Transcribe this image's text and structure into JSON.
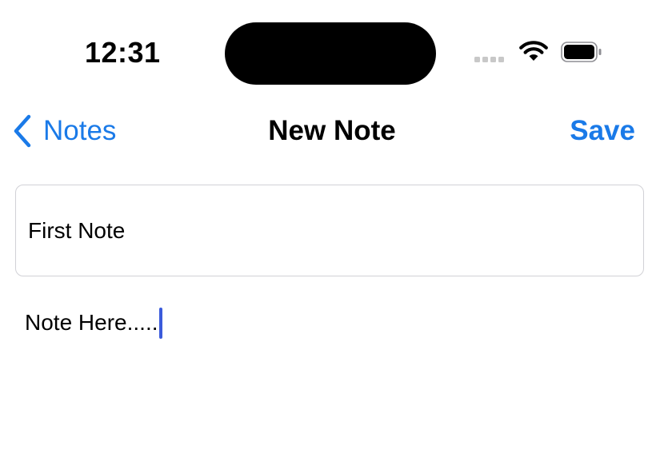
{
  "status_bar": {
    "time": "12:31",
    "signal_icon": "cellular-signal-icon",
    "wifi_icon": "wifi-icon",
    "battery_icon": "battery-icon",
    "battery_level": 1.0
  },
  "nav": {
    "back_icon": "chevron-left-icon",
    "back_label": "Notes",
    "title": "New Note",
    "save_label": "Save"
  },
  "editor": {
    "title_value": "First Note",
    "body_value": "Note Here....."
  },
  "colors": {
    "accent": "#1a7ae8",
    "caret": "#3b5bdb",
    "field_border": "#d1d1d6"
  }
}
